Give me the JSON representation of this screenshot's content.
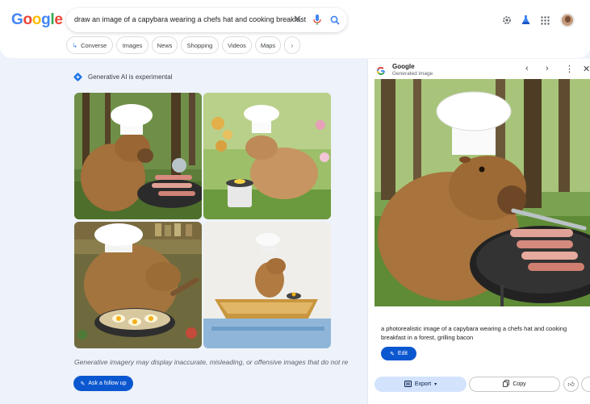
{
  "header": {
    "logo": [
      "G",
      "o",
      "o",
      "g",
      "l",
      "e"
    ],
    "search_query": "draw an image of a capybara wearing a chefs hat and cooking breakfast",
    "clear_icon": "close-icon",
    "mic_icon": "microphone-icon",
    "search_icon": "search-icon",
    "settings_icon": "gear-icon",
    "labs_icon": "labs-flask-icon",
    "apps_icon": "apps-grid-icon"
  },
  "chips": [
    {
      "label": "Converse"
    },
    {
      "label": "Images"
    },
    {
      "label": "News"
    },
    {
      "label": "Shopping"
    },
    {
      "label": "Videos"
    },
    {
      "label": "Maps"
    }
  ],
  "left": {
    "badge_label": "Generative AI is experimental",
    "disclaimer": "Generative imagery may display inaccurate, misleading, or offensive images that do not re",
    "ask_label": "Ask a follow up"
  },
  "panel": {
    "title": "Google",
    "subtitle": "Generated image",
    "caption": "a photorealistic image of a capybara wearing a chefs hat and cooking breakfast in a forest, grilling bacon",
    "edit_label": "Edit",
    "export_label": "Export",
    "copy_label": "Copy"
  },
  "colors": {
    "accent": "#0b57d0",
    "export_bg": "#d3e3fd",
    "page_bg": "#eef2fa"
  }
}
